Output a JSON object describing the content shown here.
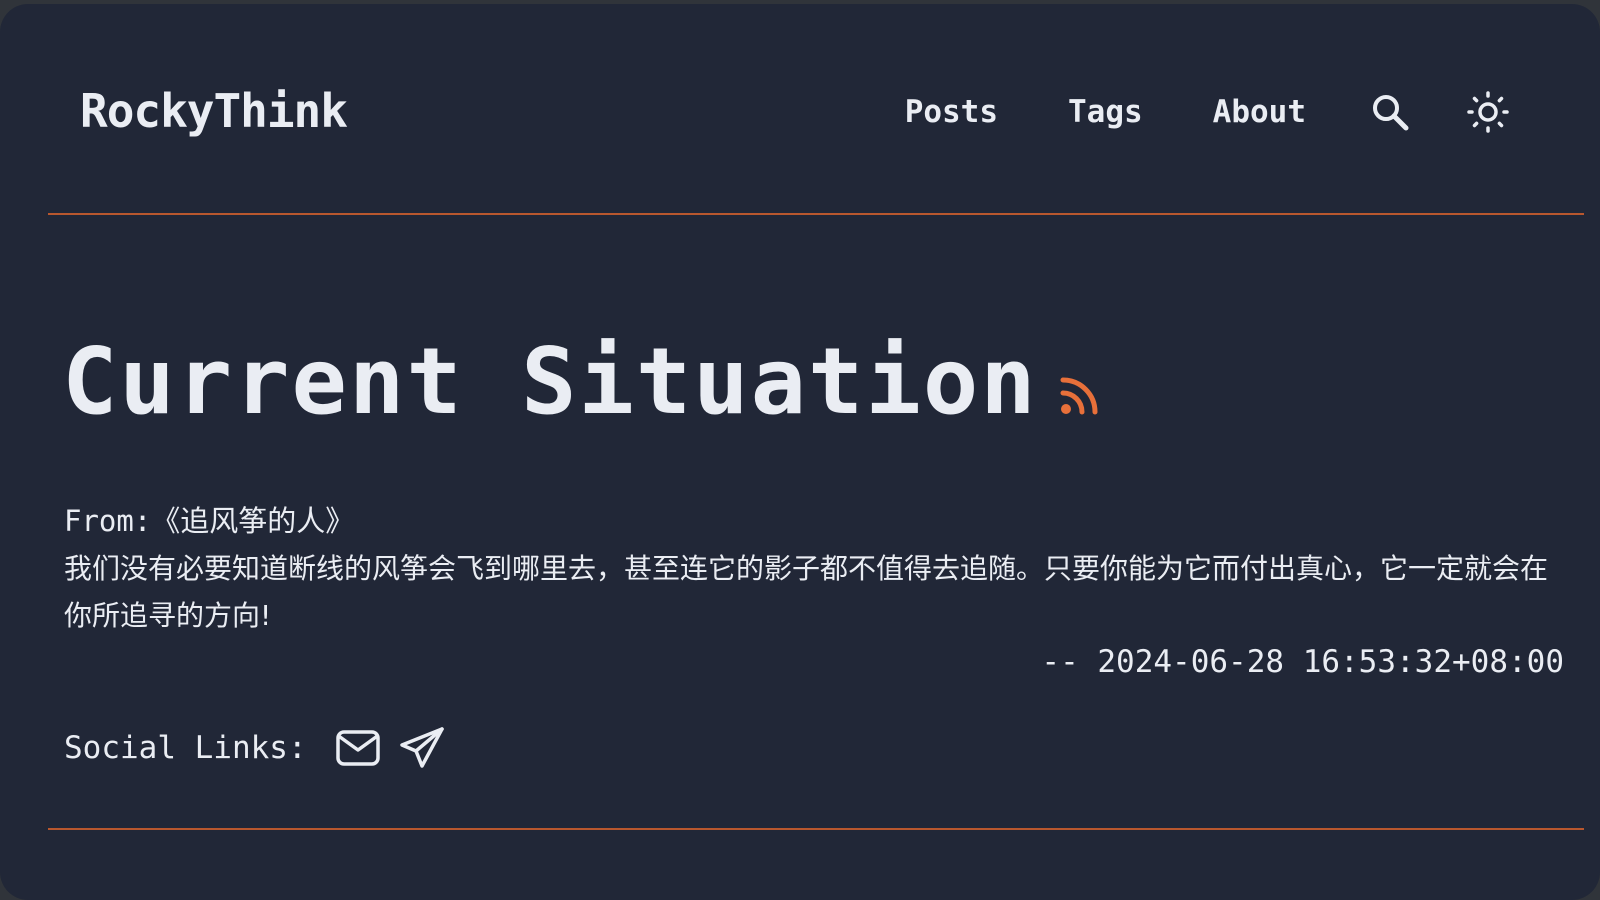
{
  "header": {
    "brand": "RockyThink",
    "nav": [
      {
        "label": "Posts"
      },
      {
        "label": "Tags"
      },
      {
        "label": "About"
      }
    ],
    "search_icon": "search-icon",
    "theme_icon": "sun-icon"
  },
  "main": {
    "title": "Current Situation",
    "rss_icon": "rss-icon",
    "quote": {
      "from": "From:《追风筝的人》",
      "text": "我们没有必要知道断线的风筝会飞到哪里去，甚至连它的影子都不值得去追随。只要你能为它而付出真心，它一定就会在你所追寻的方向!",
      "date": "-- 2024-06-28 16:53:32+08:00"
    },
    "social": {
      "label": "Social Links:",
      "links": [
        {
          "icon": "mail-icon"
        },
        {
          "icon": "telegram-icon"
        }
      ]
    }
  },
  "colors": {
    "background": "#212737",
    "text": "#eaedf3",
    "accent": "#e8703a"
  }
}
